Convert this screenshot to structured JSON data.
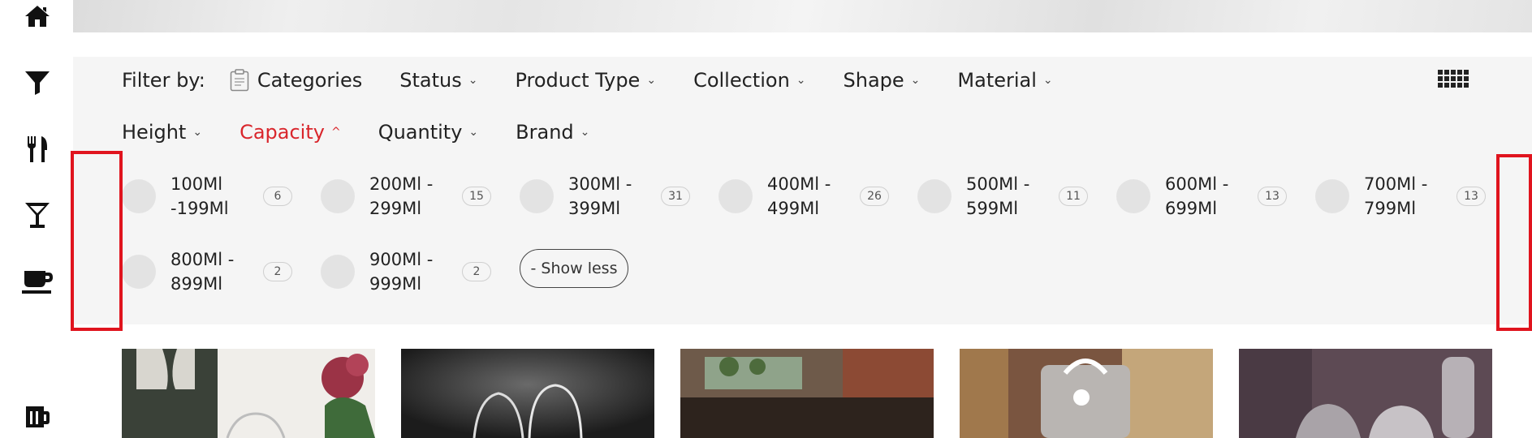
{
  "rail": {
    "icons": [
      "home-icon",
      "filter-icon",
      "dining-icon",
      "cocktail-glass-icon",
      "coffee-cup-icon",
      "beer-mug-icon"
    ]
  },
  "filters": {
    "label": "Filter by:",
    "row1": [
      {
        "label": "Categories"
      },
      {
        "label": "Status"
      },
      {
        "label": "Product Type"
      },
      {
        "label": "Collection"
      },
      {
        "label": "Shape"
      },
      {
        "label": "Material"
      }
    ],
    "row2": [
      {
        "label": "Height"
      },
      {
        "label": "Capacity",
        "active": true
      },
      {
        "label": "Quantity"
      },
      {
        "label": "Brand"
      }
    ],
    "chevron_down": "⌄",
    "chevron_up": "^",
    "active_color": "#d9262c"
  },
  "capacity": {
    "options": [
      {
        "line1": "100Ml",
        "line2": "-199Ml",
        "count": "6"
      },
      {
        "line1": "200Ml -",
        "line2": "299Ml",
        "count": "15"
      },
      {
        "line1": "300Ml -",
        "line2": "399Ml",
        "count": "31"
      },
      {
        "line1": "400Ml -",
        "line2": "499Ml",
        "count": "26"
      },
      {
        "line1": "500Ml -",
        "line2": "599Ml",
        "count": "11"
      },
      {
        "line1": "600Ml -",
        "line2": "699Ml",
        "count": "13"
      },
      {
        "line1": "700Ml -",
        "line2": "799Ml",
        "count": "13"
      },
      {
        "line1": "800Ml -",
        "line2": "899Ml",
        "count": "2"
      },
      {
        "line1": "900Ml -",
        "line2": "999Ml",
        "count": "2"
      }
    ],
    "show_less_label": "- Show less"
  },
  "highlight_color": "#e0141e"
}
